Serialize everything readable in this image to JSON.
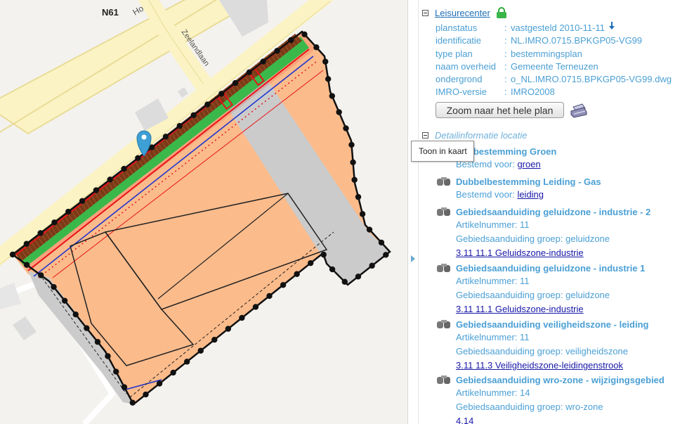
{
  "map": {
    "labels": {
      "road_n61": "N61",
      "road_ho": "Ho",
      "street_zeelandlaan": "Zeelandlaan"
    },
    "colors": {
      "background": "#f4f2ee",
      "road": "#fbf3c4",
      "road_edge": "#e9dc97",
      "building": "#dcdcdc",
      "parcel_orange": "#fbbb8b",
      "parcel_gray": "#cbcbcb",
      "strip_green": "#3bb84a",
      "strip_brown": "#7a3a16",
      "outline_red": "#e8141c",
      "pin": "#3d9fd4"
    }
  },
  "panel": {
    "plan": {
      "name": "Leisurecenter",
      "meta": [
        {
          "key": "planstatus",
          "value": "vastgesteld 2010-11-11",
          "download": true
        },
        {
          "key": "identificatie",
          "value": "NL.IMRO.0715.BPKGP05-VG99"
        },
        {
          "key": "type plan",
          "value": "bestemmingsplan"
        },
        {
          "key": "naam overheid",
          "value": "Gemeente Terneuzen"
        },
        {
          "key": "ondergrond",
          "value": "o_NL.IMRO.0715.BPKGP05-VG99.dwg"
        },
        {
          "key": "IMRO-versie",
          "value": "IMRO2008"
        }
      ],
      "separator": ":",
      "zoom_button": "Zoom naar het hele plan"
    },
    "detail_heading": "Detailinformatie locatie",
    "tooltip": "Toon in kaart",
    "entries": [
      {
        "title": "elbestemming Groen",
        "lines": [
          {
            "label": "Bestemd voor:",
            "link": "groen"
          }
        ]
      },
      {
        "title": "Dubbelbestemming Leiding - Gas",
        "lines": [
          {
            "label": "Bestemd voor:",
            "link": "leiding"
          }
        ]
      },
      {
        "title": "Gebiedsaanduiding geluidzone - industrie - 2",
        "lines": [
          {
            "label": "Artikelnummer:",
            "value": "11"
          },
          {
            "label": "Gebiedsaanduiding groep:",
            "value": "geluidzone"
          }
        ],
        "link": "3.11   11.1  Geluidszone-industrie"
      },
      {
        "title": "Gebiedsaanduiding geluidzone - industrie 1",
        "lines": [
          {
            "label": "Artikelnummer:",
            "value": "11"
          },
          {
            "label": "Gebiedsaanduiding groep:",
            "value": "geluidzone"
          }
        ],
        "link": "3.11   11.1  Geluidszone-industrie"
      },
      {
        "title": "Gebiedsaanduiding veiligheidszone - leiding",
        "lines": [
          {
            "label": "Artikelnummer:",
            "value": "11"
          },
          {
            "label": "Gebiedsaanduiding groep:",
            "value": "veiligheidszone"
          }
        ],
        "link": "3.11   11.3  Veiligheidszone-leidingenstrook"
      },
      {
        "title": "Gebiedsaanduiding wro-zone - wijzigingsgebied",
        "lines": [
          {
            "label": "Artikelnummer:",
            "value": "14"
          },
          {
            "label": "Gebiedsaanduiding groep:",
            "value": "wro-zone"
          }
        ],
        "link": "4.14"
      }
    ]
  },
  "colors": {
    "text_blue": "#4a9fd5",
    "link_blue": "#1d6fb7",
    "link_dark": "#1818a8"
  }
}
